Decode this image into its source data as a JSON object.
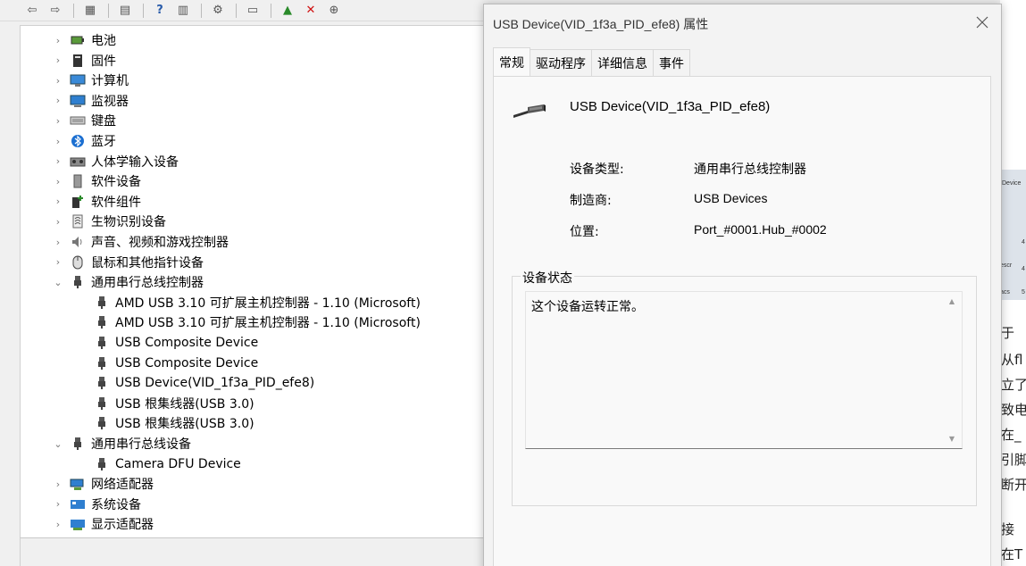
{
  "tree": {
    "items": [
      {
        "label": "电池",
        "icon": "battery-icon",
        "expanded": false,
        "level": 0
      },
      {
        "label": "固件",
        "icon": "firmware-icon",
        "expanded": false,
        "level": 0
      },
      {
        "label": "计算机",
        "icon": "computer-icon",
        "expanded": false,
        "level": 0
      },
      {
        "label": "监视器",
        "icon": "monitor-icon",
        "expanded": false,
        "level": 0
      },
      {
        "label": "键盘",
        "icon": "keyboard-icon",
        "expanded": false,
        "level": 0
      },
      {
        "label": "蓝牙",
        "icon": "bluetooth-icon",
        "expanded": false,
        "level": 0
      },
      {
        "label": "人体学输入设备",
        "icon": "hid-icon",
        "expanded": false,
        "level": 0
      },
      {
        "label": "软件设备",
        "icon": "software-device-icon",
        "expanded": false,
        "level": 0
      },
      {
        "label": "软件组件",
        "icon": "software-component-icon",
        "expanded": false,
        "level": 0
      },
      {
        "label": "生物识别设备",
        "icon": "fingerprint-icon",
        "expanded": false,
        "level": 0
      },
      {
        "label": "声音、视频和游戏控制器",
        "icon": "speaker-icon",
        "expanded": false,
        "level": 0
      },
      {
        "label": "鼠标和其他指针设备",
        "icon": "mouse-icon",
        "expanded": false,
        "level": 0
      },
      {
        "label": "通用串行总线控制器",
        "icon": "usb-icon",
        "expanded": true,
        "level": 0
      },
      {
        "label": "AMD USB 3.10 可扩展主机控制器 - 1.10 (Microsoft)",
        "icon": "usb-icon",
        "level": 1
      },
      {
        "label": "AMD USB 3.10 可扩展主机控制器 - 1.10 (Microsoft)",
        "icon": "usb-icon",
        "level": 1
      },
      {
        "label": "USB Composite Device",
        "icon": "usb-icon",
        "level": 1
      },
      {
        "label": "USB Composite Device",
        "icon": "usb-icon",
        "level": 1
      },
      {
        "label": "USB Device(VID_1f3a_PID_efe8)",
        "icon": "usb-icon",
        "level": 1
      },
      {
        "label": "USB 根集线器(USB 3.0)",
        "icon": "usb-icon",
        "level": 1
      },
      {
        "label": "USB 根集线器(USB 3.0)",
        "icon": "usb-icon",
        "level": 1
      },
      {
        "label": "通用串行总线设备",
        "icon": "usb-icon",
        "expanded": true,
        "level": 0
      },
      {
        "label": "Camera DFU Device",
        "icon": "usb-icon",
        "level": 1
      },
      {
        "label": "网络适配器",
        "icon": "network-adapter-icon",
        "expanded": false,
        "level": 0
      },
      {
        "label": "系统设备",
        "icon": "system-device-icon",
        "expanded": false,
        "level": 0
      },
      {
        "label": "显示适配器",
        "icon": "display-adapter-icon",
        "expanded": false,
        "level": 0
      }
    ]
  },
  "dialog": {
    "title": "USB Device(VID_1f3a_PID_efe8) 属性",
    "tabs": [
      {
        "label": "常规",
        "active": true
      },
      {
        "label": "驱动程序",
        "active": false
      },
      {
        "label": "详细信息",
        "active": false
      },
      {
        "label": "事件",
        "active": false
      }
    ],
    "device_name": "USB Device(VID_1f3a_PID_efe8)",
    "properties": [
      {
        "label": "设备类型:",
        "value": "通用串行总线控制器"
      },
      {
        "label": "制造商:",
        "value": "USB Devices"
      },
      {
        "label": "位置:",
        "value": "Port_#0001.Hub_#0002"
      }
    ],
    "status_legend": "设备状态",
    "status_text": "这个设备运转正常。"
  },
  "background_page": {
    "fragments": [
      "于",
      "从fl",
      "立了",
      "致电",
      "在_",
      "引脚",
      "断开",
      "接",
      "在T"
    ],
    "thumb_lines": [
      "Device",
      "4",
      "escr",
      "4",
      "acs",
      "5"
    ]
  },
  "colors": {
    "accent_orange": "#e8571e",
    "usb_grey": "#555555"
  }
}
